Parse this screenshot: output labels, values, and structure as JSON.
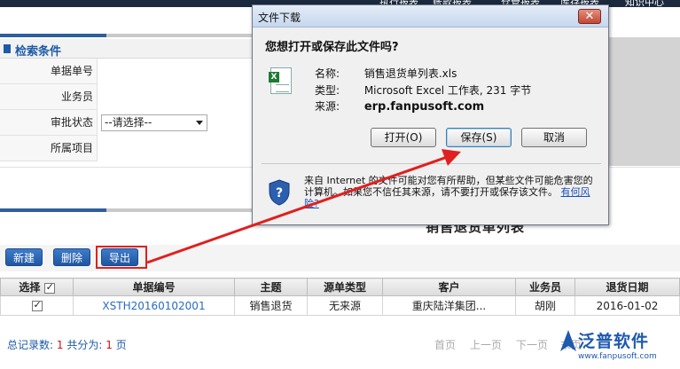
{
  "top_nav": [
    "执行报表",
    "账款报表",
    "仓管报表",
    "库存报表",
    "知识中心"
  ],
  "search_section": {
    "title": "检索条件",
    "fields": [
      {
        "label": "单据单号",
        "value": ""
      },
      {
        "label": "业务员",
        "value": ""
      },
      {
        "label": "审批状态",
        "value": "--请选择--"
      },
      {
        "label": "所属项目",
        "value": ""
      }
    ]
  },
  "list": {
    "title": "销售退货单列表",
    "buttons": {
      "new": "新建",
      "delete": "删除",
      "export": "导出"
    },
    "columns": [
      "选择",
      "单据编号",
      "主题",
      "源单类型",
      "客户",
      "业务员",
      "退货日期"
    ],
    "rows": [
      {
        "code": "XSTH20160102001",
        "subject": "销售退货",
        "source": "无来源",
        "customer": "重庆陆洋集团...",
        "salesman": "胡刚",
        "date": "2016-01-02"
      }
    ],
    "pager": {
      "total_label": "总记录数:",
      "total": "1",
      "pages_label": "共分为:",
      "pages": "1",
      "pages_unit": "页",
      "first": "首页",
      "prev": "上一页",
      "next": "下一页",
      "last": "末页"
    }
  },
  "logo": {
    "text": "泛普软件",
    "url": "www.fanpusoft.com"
  },
  "dialog": {
    "title": "文件下载",
    "close": "✕",
    "question": "您想打开或保存此文件吗?",
    "name_label": "名称:",
    "name": "销售退货单列表.xls",
    "type_label": "类型:",
    "type": "Microsoft Excel 工作表, 231 字节",
    "source_label": "来源:",
    "source": "erp.fanpusoft.com",
    "open_btn": "打开(O)",
    "save_btn": "保存(S)",
    "cancel_btn": "取消",
    "warning": "来自 Internet 的文件可能对您有所帮助，但某些文件可能危害您的计算机。如果您不信任其来源，请不要打开或保存该文件。",
    "risk_link": "有何风险?"
  },
  "colors": {
    "accent": "#1d5ba6",
    "highlight": "#e02020",
    "arrow": "#e02020"
  }
}
